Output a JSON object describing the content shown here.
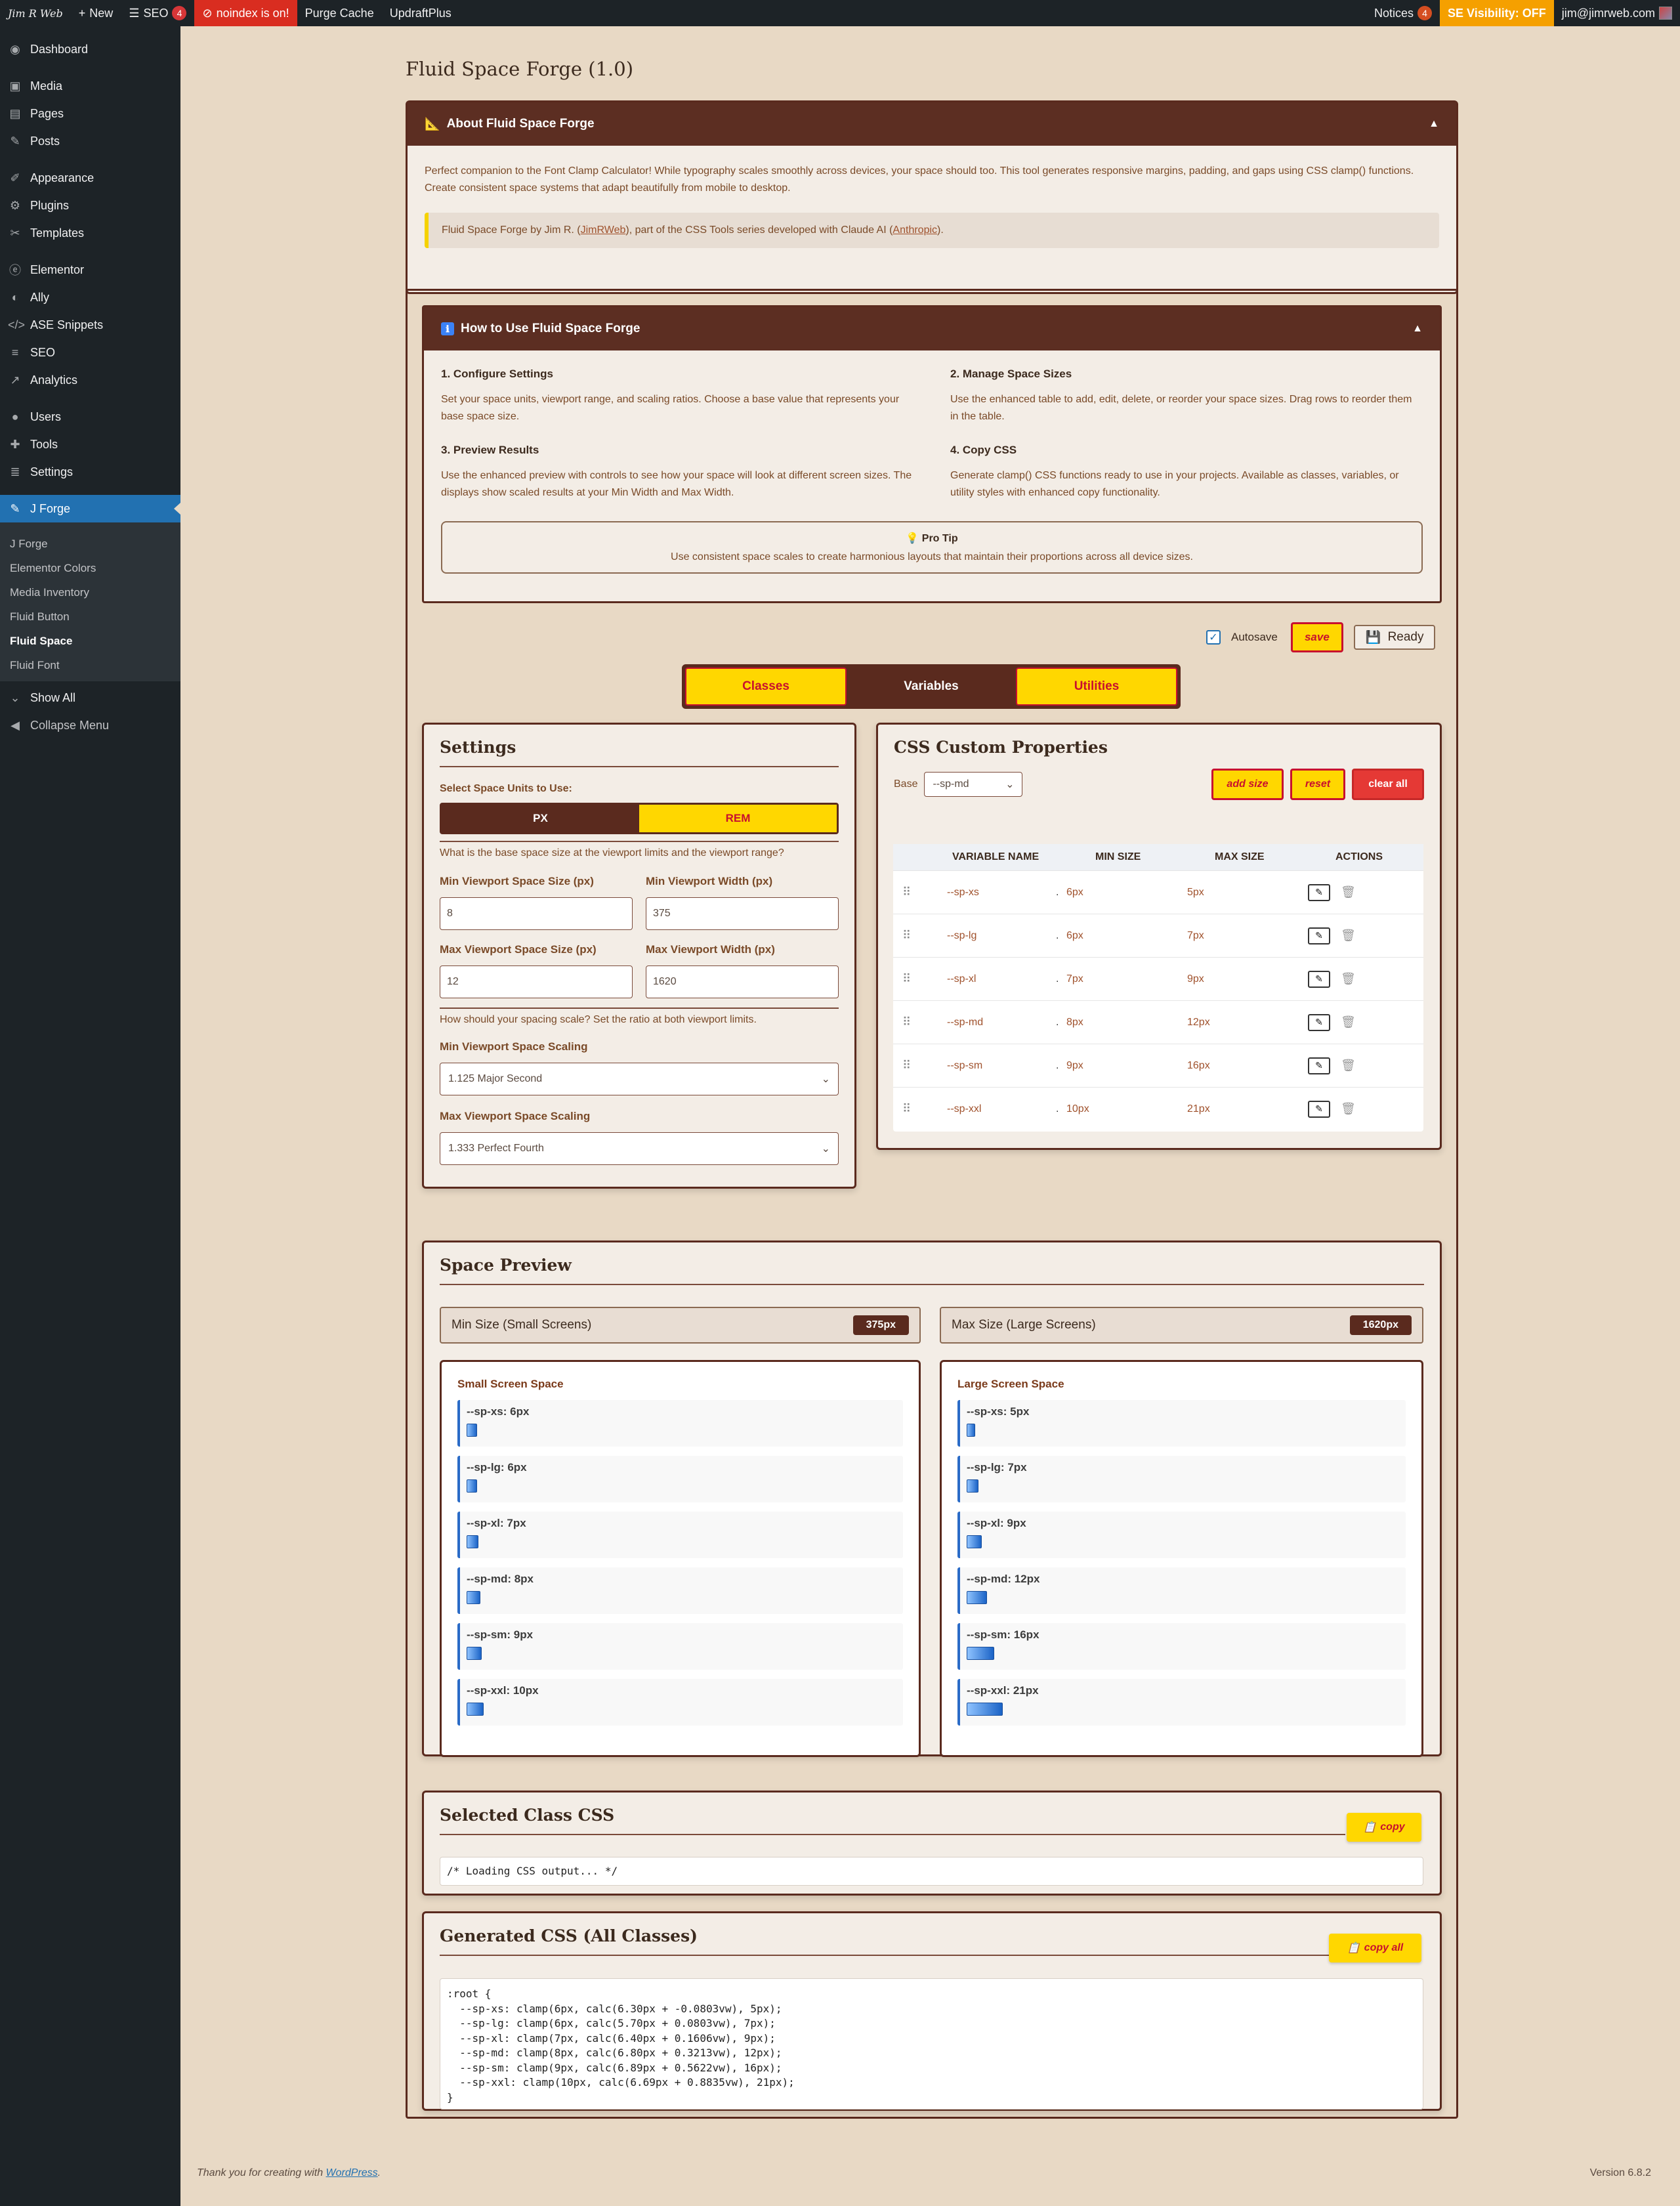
{
  "adminbar": {
    "logo": "Jim R Web",
    "new": "New",
    "seo": "SEO",
    "seo_count": "4",
    "noindex": "noindex is on!",
    "purge": "Purge Cache",
    "updraft": "UpdraftPlus",
    "notices": "Notices",
    "notices_count": "4",
    "se_visibility": "SE Visibility: OFF",
    "user": "jim@jimrweb.com"
  },
  "sidebar": {
    "items": [
      {
        "icon": "dashboard-icon",
        "glyph": "◉",
        "label": "Dashboard"
      },
      {
        "icon": "media-icon",
        "glyph": "▣",
        "label": "Media"
      },
      {
        "icon": "pages-icon",
        "glyph": "▤",
        "label": "Pages"
      },
      {
        "icon": "posts-icon",
        "glyph": "✎",
        "label": "Posts"
      },
      {
        "icon": "appearance-icon",
        "glyph": "✐",
        "label": "Appearance"
      },
      {
        "icon": "plugins-icon",
        "glyph": "⚙",
        "label": "Plugins"
      },
      {
        "icon": "templates-icon",
        "glyph": "✂",
        "label": "Templates"
      },
      {
        "icon": "elementor-icon",
        "glyph": "ⓔ",
        "label": "Elementor"
      },
      {
        "icon": "ally-icon",
        "glyph": "◐",
        "label": "Ally"
      },
      {
        "icon": "code-icon",
        "glyph": "</>",
        "label": "ASE Snippets"
      },
      {
        "icon": "seo-icon",
        "glyph": "≡",
        "label": "SEO"
      },
      {
        "icon": "analytics-icon",
        "glyph": "↗",
        "label": "Analytics"
      },
      {
        "icon": "users-icon",
        "glyph": "●",
        "label": "Users"
      },
      {
        "icon": "tools-icon",
        "glyph": "✚",
        "label": "Tools"
      },
      {
        "icon": "settings-icon",
        "glyph": "≣",
        "label": "Settings"
      }
    ],
    "active": {
      "icon": "wrench-icon",
      "glyph": "✎",
      "label": "J Forge"
    },
    "submenu": [
      "J Forge",
      "Elementor Colors",
      "Media Inventory",
      "Fluid Button",
      "Fluid Space",
      "Fluid Font"
    ],
    "submenu_current": "Fluid Space",
    "show_all": "Show All",
    "collapse": "Collapse Menu"
  },
  "page_title": "Fluid Space Forge (1.0)",
  "about": {
    "icon": "📐",
    "title": "About Fluid Space Forge",
    "text": "Perfect companion to the Font Clamp Calculator! While typography scales smoothly across devices, your space should too. This tool generates responsive margins, padding, and gaps using CSS clamp() functions. Create consistent space systems that adapt beautifully from mobile to desktop.",
    "credit_pre": "Fluid Space Forge by Jim R. (",
    "credit_link1": "JimRWeb",
    "credit_mid": "), part of the CSS Tools series developed with Claude AI (",
    "credit_link2": "Anthropic",
    "credit_post": ")."
  },
  "howto": {
    "icon": "ℹ",
    "title": "How to Use Fluid Space Forge",
    "steps": [
      {
        "title": "1. Configure Settings",
        "text": "Set your space units, viewport range, and scaling ratios. Choose a base value that represents your base space size."
      },
      {
        "title": "2. Manage Space Sizes",
        "text": "Use the enhanced table to add, edit, delete, or reorder your space sizes. Drag rows to reorder them in the table."
      },
      {
        "title": "3. Preview Results",
        "text": "Use the enhanced preview with controls to see how your space will look at different screen sizes. The displays show scaled results at your Min Width and Max Width."
      },
      {
        "title": "4. Copy CSS",
        "text": "Generate clamp() CSS functions ready to use in your projects. Available as classes, variables, or utility styles with enhanced copy functionality."
      }
    ],
    "protip_title": "Pro Tip",
    "protip_text": "Use consistent space scales to create harmonious layouts that maintain their proportions across all device sizes."
  },
  "controls": {
    "autosave": "Autosave",
    "save": "save",
    "ready": "Ready"
  },
  "tabs": [
    "Classes",
    "Variables",
    "Utilities"
  ],
  "tab_active": "Variables",
  "settings": {
    "title": "Settings",
    "units_label": "Select Space Units to Use:",
    "unit_px": "PX",
    "unit_rem": "REM",
    "base_question": "What is the base space size at the viewport limits and the viewport range?",
    "min_space_label": "Min Viewport Space Size (px)",
    "min_space_value": "8",
    "min_width_label": "Min Viewport Width (px)",
    "min_width_value": "375",
    "max_space_label": "Max Viewport Space Size (px)",
    "max_space_value": "12",
    "max_width_label": "Max Viewport Width (px)",
    "max_width_value": "1620",
    "scale_question": "How should your spacing scale? Set the ratio at both viewport limits.",
    "min_scaling_label": "Min Viewport Space Scaling",
    "min_scaling_value": "1.125 Major Second",
    "max_scaling_label": "Max Viewport Space Scaling",
    "max_scaling_value": "1.333 Perfect Fourth"
  },
  "props": {
    "title": "CSS Custom Properties",
    "base_label": "Base",
    "base_value": "--sp-md",
    "add": "add size",
    "reset": "reset",
    "clear": "clear all",
    "headers": [
      "VARIABLE NAME",
      "MIN SIZE",
      "MAX SIZE",
      "ACTIONS"
    ],
    "rows": [
      {
        "name": "--sp-xs",
        "dot": ".",
        "min": "6px",
        "max": "5px"
      },
      {
        "name": "--sp-lg",
        "dot": ".",
        "min": "6px",
        "max": "7px"
      },
      {
        "name": "--sp-xl",
        "dot": ".",
        "min": "7px",
        "max": "9px"
      },
      {
        "name": "--sp-md",
        "dot": ".",
        "min": "8px",
        "max": "12px"
      },
      {
        "name": "--sp-sm",
        "dot": ".",
        "min": "9px",
        "max": "16px"
      },
      {
        "name": "--sp-xxl",
        "dot": ".",
        "min": "10px",
        "max": "21px"
      }
    ]
  },
  "preview": {
    "title": "Space Preview",
    "min_label": "Min Size (Small Screens)",
    "min_badge": "375px",
    "max_label": "Max Size (Large Screens)",
    "max_badge": "1620px",
    "small_title": "Small Screen Space",
    "large_title": "Large Screen Space",
    "small": [
      {
        "label": "--sp-xs: 6px",
        "size": 6
      },
      {
        "label": "--sp-lg: 6px",
        "size": 6
      },
      {
        "label": "--sp-xl: 7px",
        "size": 7
      },
      {
        "label": "--sp-md: 8px",
        "size": 8
      },
      {
        "label": "--sp-sm: 9px",
        "size": 9
      },
      {
        "label": "--sp-xxl: 10px",
        "size": 10
      }
    ],
    "large": [
      {
        "label": "--sp-xs: 5px",
        "size": 5
      },
      {
        "label": "--sp-lg: 7px",
        "size": 7
      },
      {
        "label": "--sp-xl: 9px",
        "size": 9
      },
      {
        "label": "--sp-md: 12px",
        "size": 12
      },
      {
        "label": "--sp-sm: 16px",
        "size": 16
      },
      {
        "label": "--sp-xxl: 21px",
        "size": 21
      }
    ]
  },
  "selected_css": {
    "title": "Selected Class CSS",
    "copy": "copy",
    "code": "/* Loading CSS output... */"
  },
  "generated_css": {
    "title": "Generated CSS (All Classes)",
    "copy": "copy all",
    "code": ":root {\n  --sp-xs: clamp(6px, calc(6.30px + -0.0803vw), 5px);\n  --sp-lg: clamp(6px, calc(5.70px + 0.0803vw), 7px);\n  --sp-xl: clamp(7px, calc(6.40px + 0.1606vw), 9px);\n  --sp-md: clamp(8px, calc(6.80px + 0.3213vw), 12px);\n  --sp-sm: clamp(9px, calc(6.89px + 0.5622vw), 16px);\n  --sp-xxl: clamp(10px, calc(6.69px + 0.8835vw), 21px);\n}"
  },
  "footer": {
    "thanks_pre": "Thank you for creating with ",
    "thanks_link": "WordPress",
    "thanks_post": ".",
    "version": "Version 6.8.2"
  }
}
